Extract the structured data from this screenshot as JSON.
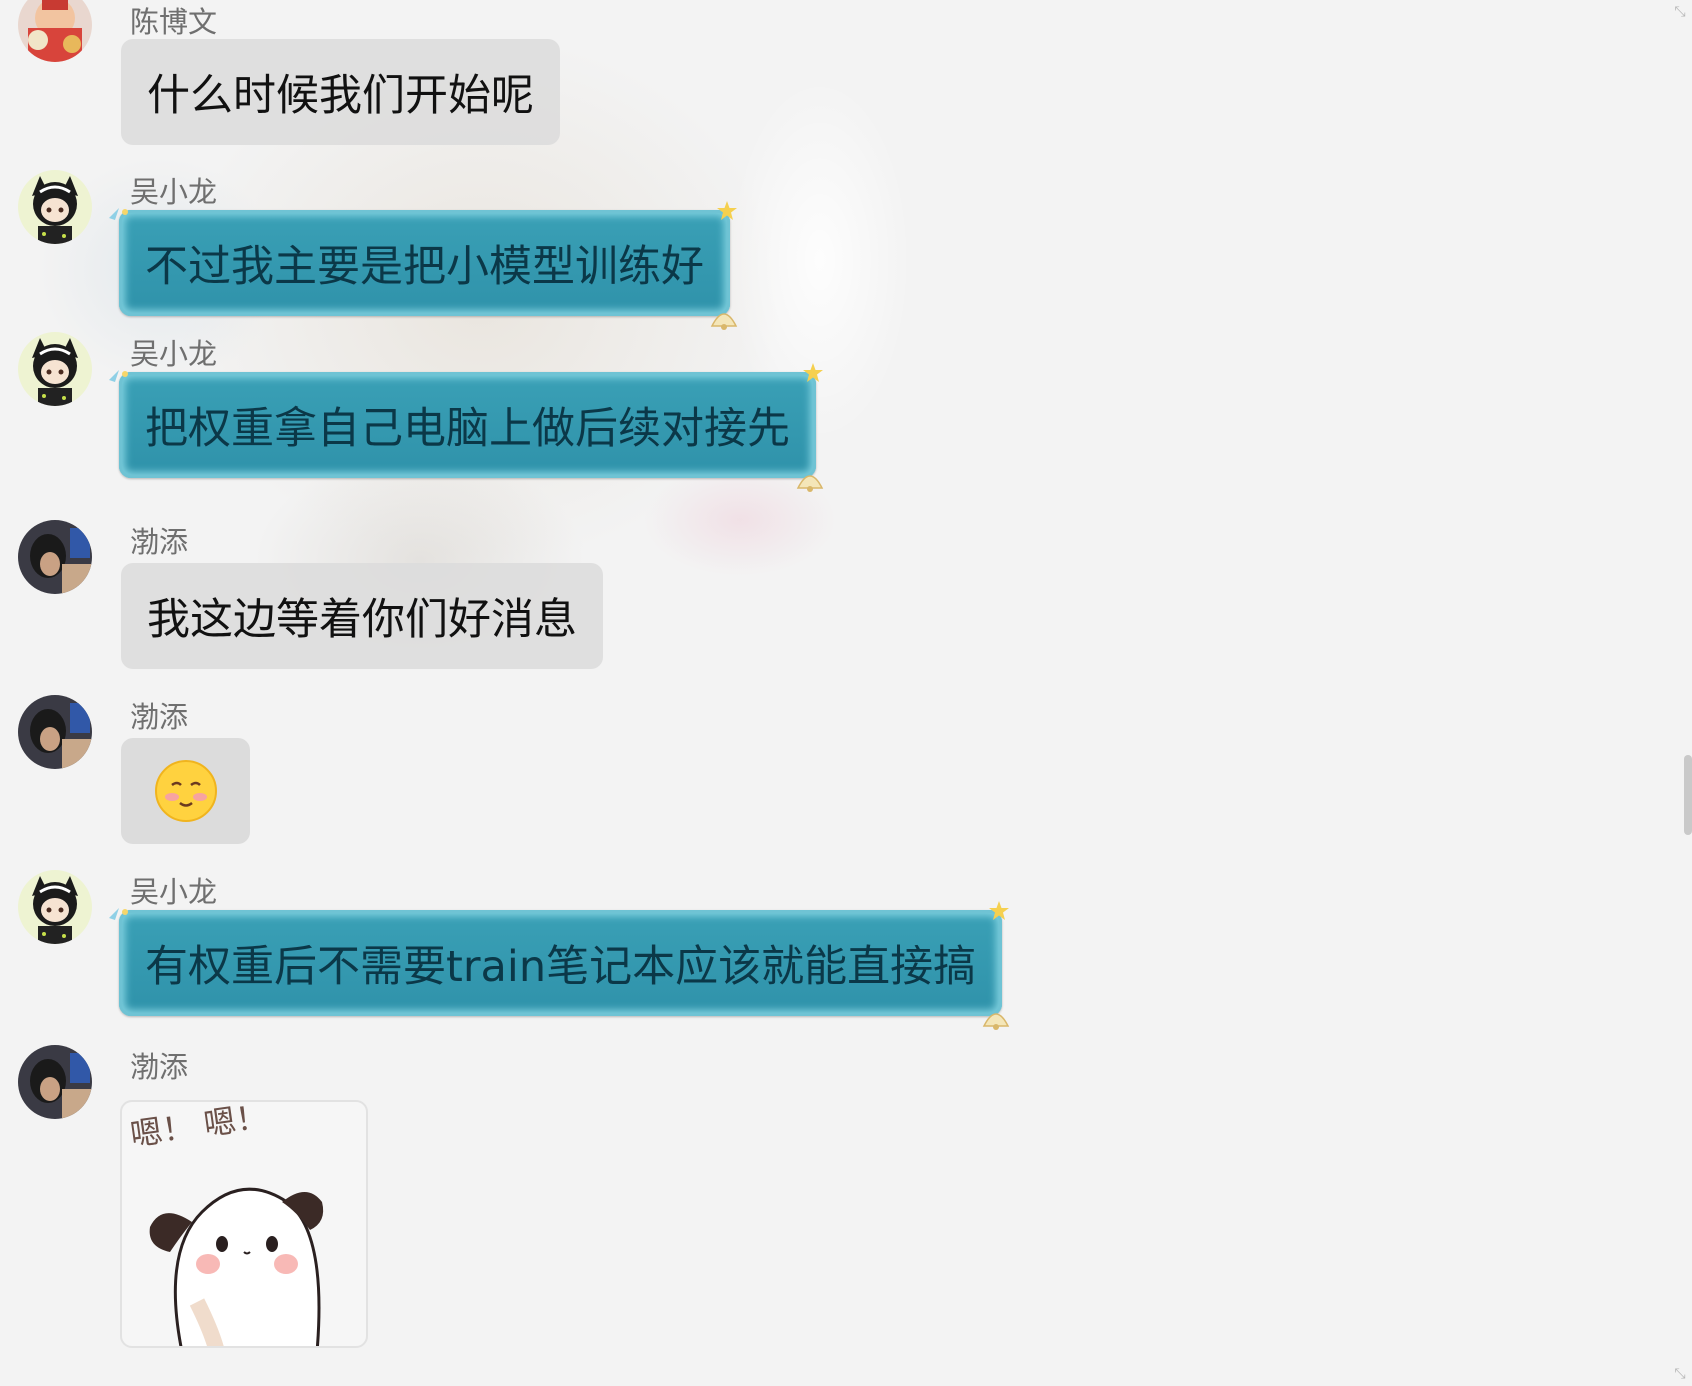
{
  "chat": {
    "messages": [
      {
        "sender": "陈博文",
        "type": "text",
        "style": "gray",
        "text": "什么时候我们开始呢",
        "avatar": "avatar-chenbowen"
      },
      {
        "sender": "吴小龙",
        "type": "text",
        "style": "teal",
        "text": "不过我主要是把小模型训练好",
        "avatar": "avatar-wuxiaolong"
      },
      {
        "sender": "吴小龙",
        "type": "text",
        "style": "teal",
        "text": "把权重拿自己电脑上做后续对接先",
        "avatar": "avatar-wuxiaolong"
      },
      {
        "sender": "渤添",
        "type": "text",
        "style": "gray",
        "text": "我这边等着你们好消息",
        "avatar": "avatar-botian"
      },
      {
        "sender": "渤添",
        "type": "emoji",
        "style": "gray",
        "emoji": "shy-smile-emoji",
        "avatar": "avatar-botian"
      },
      {
        "sender": "吴小龙",
        "type": "text",
        "style": "teal",
        "text": "有权重后不需要train笔记本应该就能直接搞",
        "avatar": "avatar-wuxiaolong"
      },
      {
        "sender": "渤添",
        "type": "sticker",
        "sticker_caption": "嗯！ 嗯！",
        "sticker": "puppy-sticker",
        "avatar": "avatar-botian"
      }
    ]
  },
  "colors": {
    "teal_bubble": "#3aa0b6",
    "teal_text": "#0b3848",
    "gray_bubble": "#dcdcdc",
    "background": "#f3f3f3",
    "sender_name": "#6f6f6f"
  },
  "icons": {
    "scroll_top": "scroll-up-icon",
    "scroll_bottom": "scroll-down-icon"
  }
}
